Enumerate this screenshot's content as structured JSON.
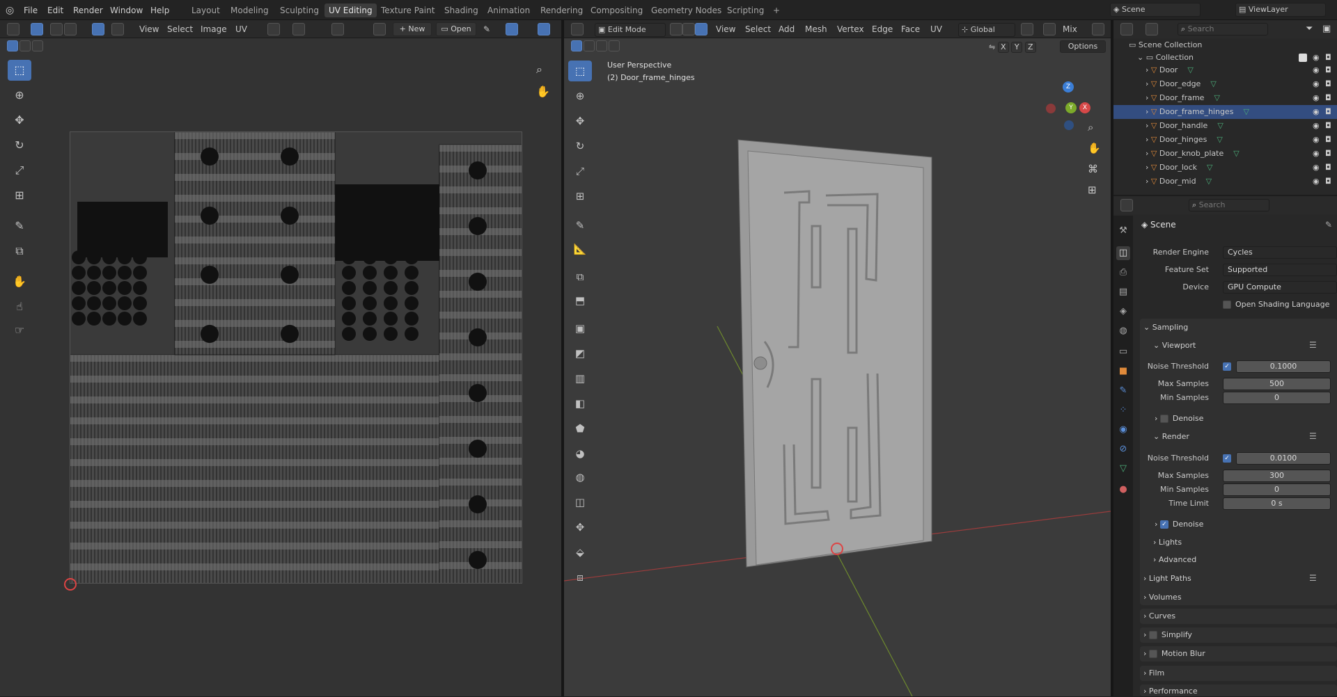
{
  "app": {
    "menu": [
      "File",
      "Edit",
      "Render",
      "Window",
      "Help"
    ],
    "workspaces": [
      "Layout",
      "Modeling",
      "Sculpting",
      "UV Editing",
      "Texture Paint",
      "Shading",
      "Animation",
      "Rendering",
      "Compositing",
      "Geometry Nodes",
      "Scripting"
    ],
    "active_workspace": "UV Editing",
    "add_workspace": "+",
    "scene_name": "Scene",
    "view_layer": "ViewLayer"
  },
  "uv_editor": {
    "menu": [
      "View",
      "Select",
      "Image",
      "UV"
    ],
    "new_label": "New",
    "open_label": "Open"
  },
  "viewport": {
    "mode": "Edit Mode",
    "menu": [
      "View",
      "Select",
      "Add",
      "Mesh",
      "Vertex",
      "Edge",
      "Face",
      "UV"
    ],
    "transform": "Global",
    "shading": "Mix",
    "options_label": "Options",
    "axes": [
      "X",
      "Y",
      "Z"
    ],
    "perspective": "User Perspective",
    "object_info": "(2) Door_frame_hinges",
    "gizmo": {
      "x": "X",
      "y": "Y",
      "z": "Z"
    }
  },
  "outliner": {
    "search_placeholder": "Search",
    "scene_collection": "Scene Collection",
    "collection": "Collection",
    "objects": [
      "Door",
      "Door_edge",
      "Door_frame",
      "Door_frame_hinges",
      "Door_handle",
      "Door_hinges",
      "Door_knob_plate",
      "Door_lock",
      "Door_mid"
    ],
    "selected": "Door_frame_hinges"
  },
  "properties": {
    "search_placeholder": "Search",
    "context": "Scene",
    "render_engine_label": "Render Engine",
    "render_engine": "Cycles",
    "feature_set_label": "Feature Set",
    "feature_set": "Supported",
    "device_label": "Device",
    "device": "GPU Compute",
    "osl_label": "Open Shading Language",
    "sampling": "Sampling",
    "viewport": "Viewport",
    "noise_threshold_label": "Noise Threshold",
    "vp_noise_threshold": "0.1000",
    "max_samples_label": "Max Samples",
    "vp_max_samples": "500",
    "min_samples_label": "Min Samples",
    "vp_min_samples": "0",
    "denoise_label": "Denoise",
    "render": "Render",
    "r_noise_threshold": "0.0100",
    "r_max_samples": "300",
    "r_min_samples": "0",
    "time_limit_label": "Time Limit",
    "r_time_limit": "0 s",
    "lights": "Lights",
    "advanced": "Advanced",
    "light_paths": "Light Paths",
    "volumes": "Volumes",
    "curves": "Curves",
    "simplify": "Simplify",
    "motion_blur": "Motion Blur",
    "film": "Film",
    "performance": "Performance"
  }
}
